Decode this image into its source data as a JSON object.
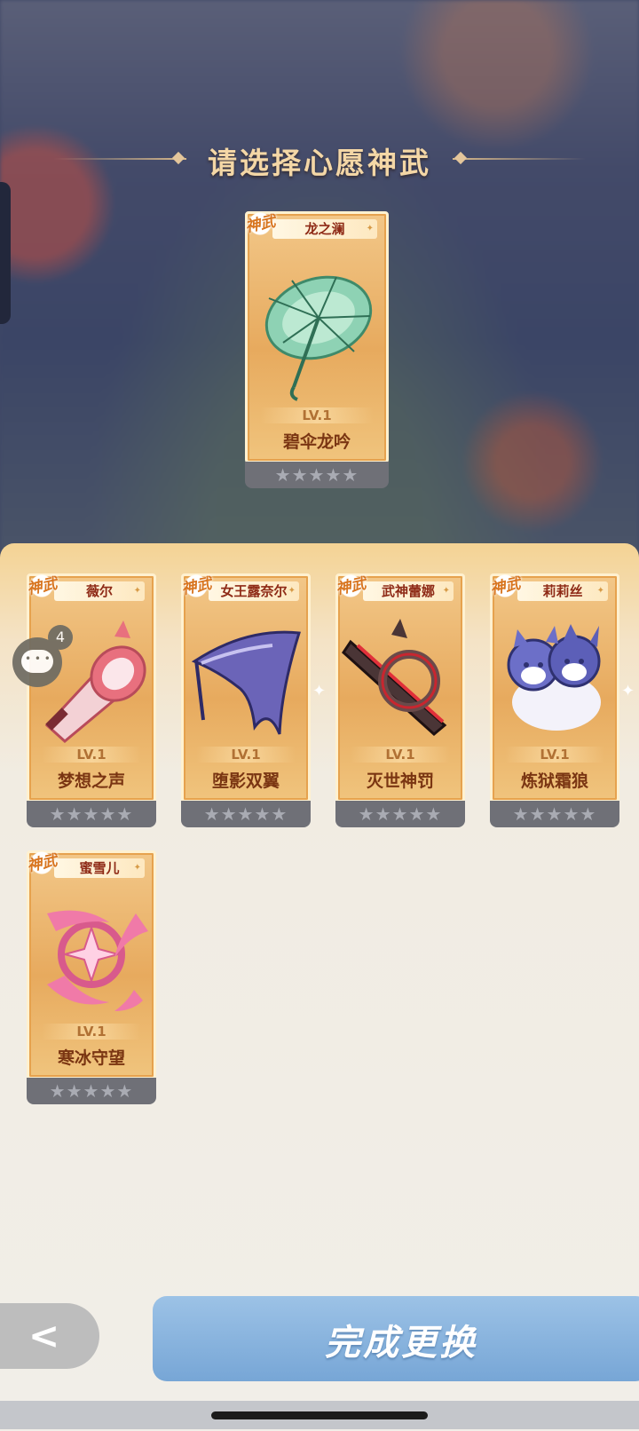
{
  "title": "请选择心愿神武",
  "badge_label": "神武",
  "featured": {
    "owner": "龙之澜",
    "level": "LV.1",
    "weapon": "碧伞龙吟",
    "stars": "★★★★★",
    "art_icon": "jade-umbrella-icon"
  },
  "options": [
    {
      "owner": "薇尔",
      "level": "LV.1",
      "weapon": "梦想之声",
      "stars": "★★★★★",
      "art_icon": "megaphone-icon"
    },
    {
      "owner": "女王露奈尔",
      "level": "LV.1",
      "weapon": "堕影双翼",
      "stars": "★★★★★",
      "art_icon": "bat-wing-blade-icon"
    },
    {
      "owner": "武神蕾娜",
      "level": "LV.1",
      "weapon": "灭世神罚",
      "stars": "★★★★★",
      "art_icon": "crimson-blade-icon"
    },
    {
      "owner": "莉莉丝",
      "level": "LV.1",
      "weapon": "炼狱霜狼",
      "stars": "★★★★★",
      "art_icon": "twin-wolves-icon"
    },
    {
      "owner": "蜜雪儿",
      "level": "LV.1",
      "weapon": "寒冰守望",
      "stars": "★★★★★",
      "art_icon": "pink-feather-ring-icon"
    }
  ],
  "chat": {
    "count": "4"
  },
  "buttons": {
    "back": "<",
    "done": "完成更换"
  }
}
